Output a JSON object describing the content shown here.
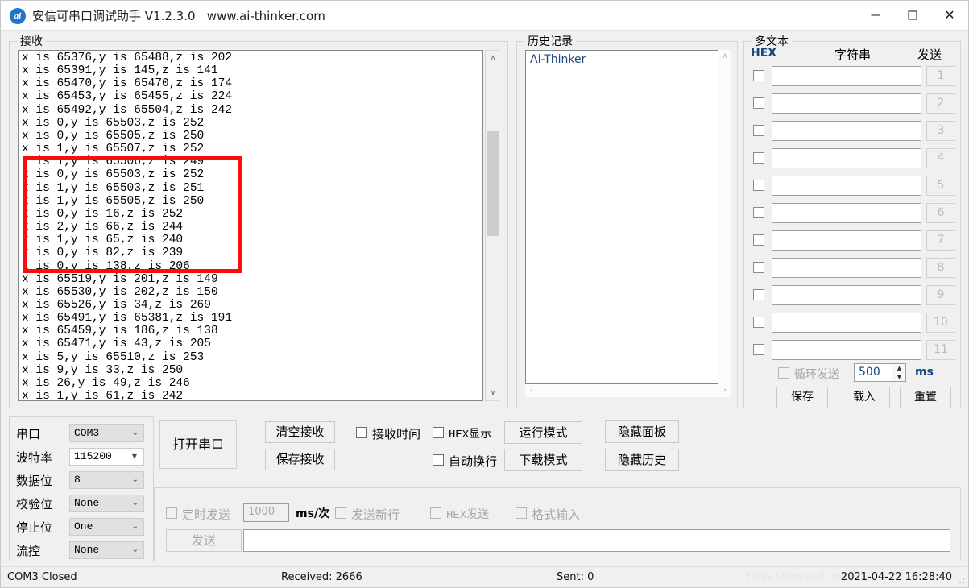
{
  "window": {
    "app_icon_text": "ai",
    "title": "安信可串口调试助手 V1.2.3.0   www.ai-thinker.com",
    "minimize_label": "minimize",
    "maximize_label": "maximize",
    "close_label": "✕"
  },
  "receive": {
    "legend": "接收",
    "text": "x is 65376,y is 65488,z is 202\nx is 65391,y is 145,z is 141\nx is 65470,y is 65470,z is 174\nx is 65453,y is 65455,z is 224\nx is 65492,y is 65504,z is 242\nx is 0,y is 65503,z is 252\nx is 0,y is 65505,z is 250\nx is 1,y is 65507,z is 252\nx is 1,y is 65506,z is 249\nx is 0,y is 65503,z is 252\nx is 1,y is 65503,z is 251\nx is 1,y is 65505,z is 250\nx is 0,y is 16,z is 252\nx is 2,y is 66,z is 244\nx is 1,y is 65,z is 240\nx is 0,y is 82,z is 239\nx is 0,y is 138,z is 206\nx is 65519,y is 201,z is 149\nx is 65530,y is 202,z is 150\nx is 65526,y is 34,z is 269\nx is 65491,y is 65381,z is 191\nx is 65459,y is 186,z is 138\nx is 65471,y is 43,z is 205\nx is 5,y is 65510,z is 253\nx is 9,y is 33,z is 250\nx is 26,y is 49,z is 246\nx is 1,y is 61,z is 242",
    "scroll_up_glyph": "∧",
    "scroll_down_glyph": "∨",
    "annotation_color": "#fb0d0d"
  },
  "history": {
    "legend": "历史记录",
    "items": [
      "Ai-Thinker"
    ],
    "scroll_up_glyph": "∧",
    "scroll_left_glyph": "‹",
    "scroll_right_glyph": "›"
  },
  "multitext": {
    "legend": "多文本",
    "header_hex": "HEX",
    "header_string": "字符串",
    "header_send": "发送",
    "rows": [
      {
        "value": "",
        "send_label": "1"
      },
      {
        "value": "",
        "send_label": "2"
      },
      {
        "value": "",
        "send_label": "3"
      },
      {
        "value": "",
        "send_label": "4"
      },
      {
        "value": "",
        "send_label": "5"
      },
      {
        "value": "",
        "send_label": "6"
      },
      {
        "value": "",
        "send_label": "7"
      },
      {
        "value": "",
        "send_label": "8"
      },
      {
        "value": "",
        "send_label": "9"
      },
      {
        "value": "",
        "send_label": "10"
      },
      {
        "value": "",
        "send_label": "11"
      }
    ],
    "loop_send_label": "循环发送",
    "loop_interval": "500",
    "loop_unit": "ms",
    "spin_up_glyph": "▲",
    "spin_down_glyph": "▼",
    "save_label": "保存",
    "load_label": "载入",
    "reset_label": "重置"
  },
  "serial": {
    "legend": "",
    "fields": [
      {
        "label": "串口",
        "value": "COM3",
        "editable": false
      },
      {
        "label": "波特率",
        "value": "115200",
        "editable": true
      },
      {
        "label": "数据位",
        "value": "8",
        "editable": false
      },
      {
        "label": "校验位",
        "value": "None",
        "editable": false
      },
      {
        "label": "停止位",
        "value": "One",
        "editable": false
      },
      {
        "label": "流控",
        "value": "None",
        "editable": false
      }
    ],
    "open_port_label": "打开串口"
  },
  "recv_controls": {
    "clear_receive": "清空接收",
    "save_receive": "保存接收",
    "recv_time_label": "接收时间",
    "hex_show_label": "HEX显示",
    "auto_wrap_label": "自动换行",
    "run_mode": "运行模式",
    "download_mode": "下载模式",
    "hide_panel": "隐藏面板",
    "hide_history": "隐藏历史"
  },
  "send": {
    "timed_send_label": "定时发送",
    "timed_interval": "1000",
    "ms_label": "ms/次",
    "send_newline_label": "发送新行",
    "hex_send_label": "HEX发送",
    "format_input_label": "格式输入",
    "send_button": "发送",
    "input_value": ""
  },
  "statusbar": {
    "port_status": "COM3 Closed",
    "received": "Received: 2666",
    "sent": "Sent: 0",
    "datetime": "2021-04-22 16:28:40",
    "watermark": "https://blog.csdn.net"
  }
}
